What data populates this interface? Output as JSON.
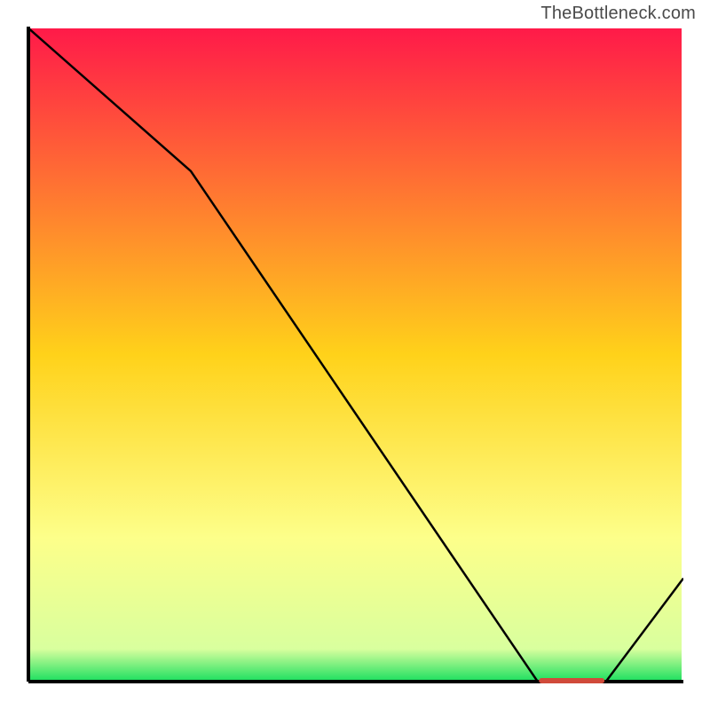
{
  "attribution": "TheBottleneck.com",
  "chart_data": {
    "type": "line",
    "title": "",
    "xlabel": "",
    "ylabel": "",
    "xlim": [
      0,
      100
    ],
    "ylim": [
      0,
      100
    ],
    "x": [
      0,
      25,
      78,
      88,
      100
    ],
    "values": [
      100,
      78,
      0,
      0,
      16
    ],
    "optimum_marker": {
      "x_start": 78,
      "x_end": 88,
      "y": 0
    },
    "background_gradient_stops": [
      {
        "offset": 0.0,
        "color": "#ff1a49"
      },
      {
        "offset": 0.5,
        "color": "#ffd21a"
      },
      {
        "offset": 0.78,
        "color": "#fdff8a"
      },
      {
        "offset": 0.95,
        "color": "#d9ff9e"
      },
      {
        "offset": 1.0,
        "color": "#1adf5f"
      }
    ]
  }
}
